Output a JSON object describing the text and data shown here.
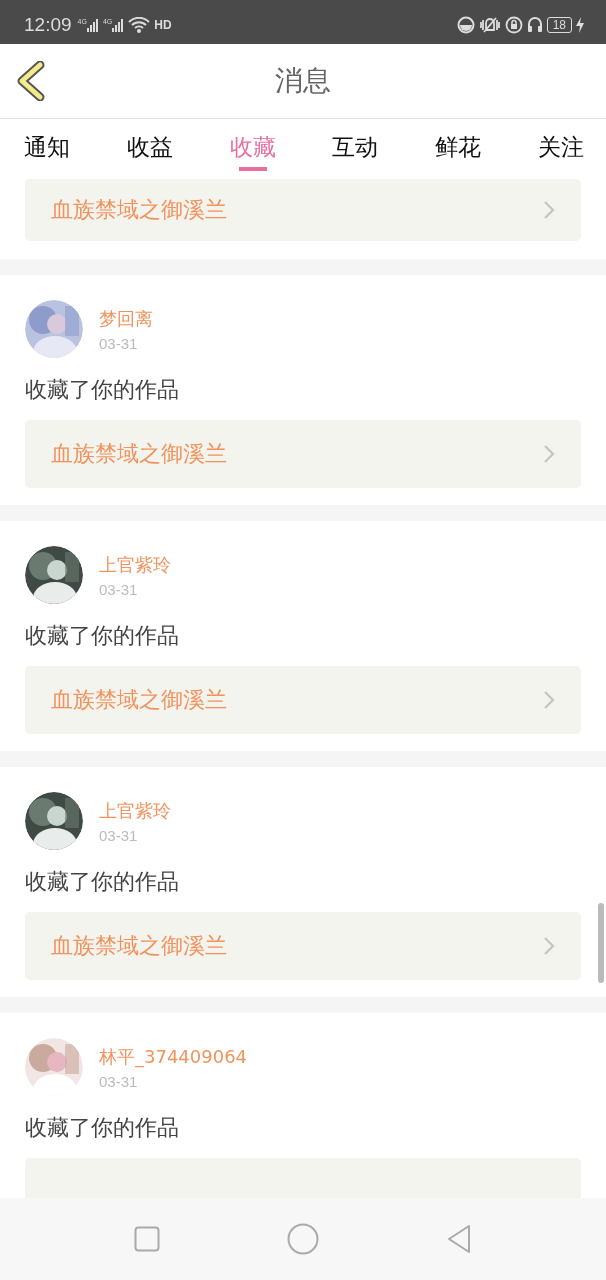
{
  "status_bar": {
    "time": "12:09",
    "networks": [
      "4G",
      "4G"
    ],
    "hd": "HD",
    "battery": "18"
  },
  "header": {
    "title": "消息"
  },
  "tabs": [
    {
      "label": "通知",
      "selected": false
    },
    {
      "label": "收益",
      "selected": false
    },
    {
      "label": "收藏",
      "selected": true
    },
    {
      "label": "互动",
      "selected": false
    },
    {
      "label": "鲜花",
      "selected": false
    },
    {
      "label": "关注",
      "selected": false
    }
  ],
  "items": [
    {
      "kind": "link_only",
      "link": "血族禁域之御溪兰"
    },
    {
      "kind": "card",
      "user": "梦回离",
      "date": "03-31",
      "action": "收藏了你的作品",
      "link": "血族禁域之御溪兰"
    },
    {
      "kind": "card",
      "user": "上官紫玲",
      "date": "03-31",
      "action": "收藏了你的作品",
      "link": "血族禁域之御溪兰"
    },
    {
      "kind": "card",
      "user": "上官紫玲",
      "date": "03-31",
      "action": "收藏了你的作品",
      "link": "血族禁域之御溪兰"
    },
    {
      "kind": "card",
      "user": "林平_374409064",
      "date": "03-31",
      "action": "收藏了你的作品"
    }
  ]
}
